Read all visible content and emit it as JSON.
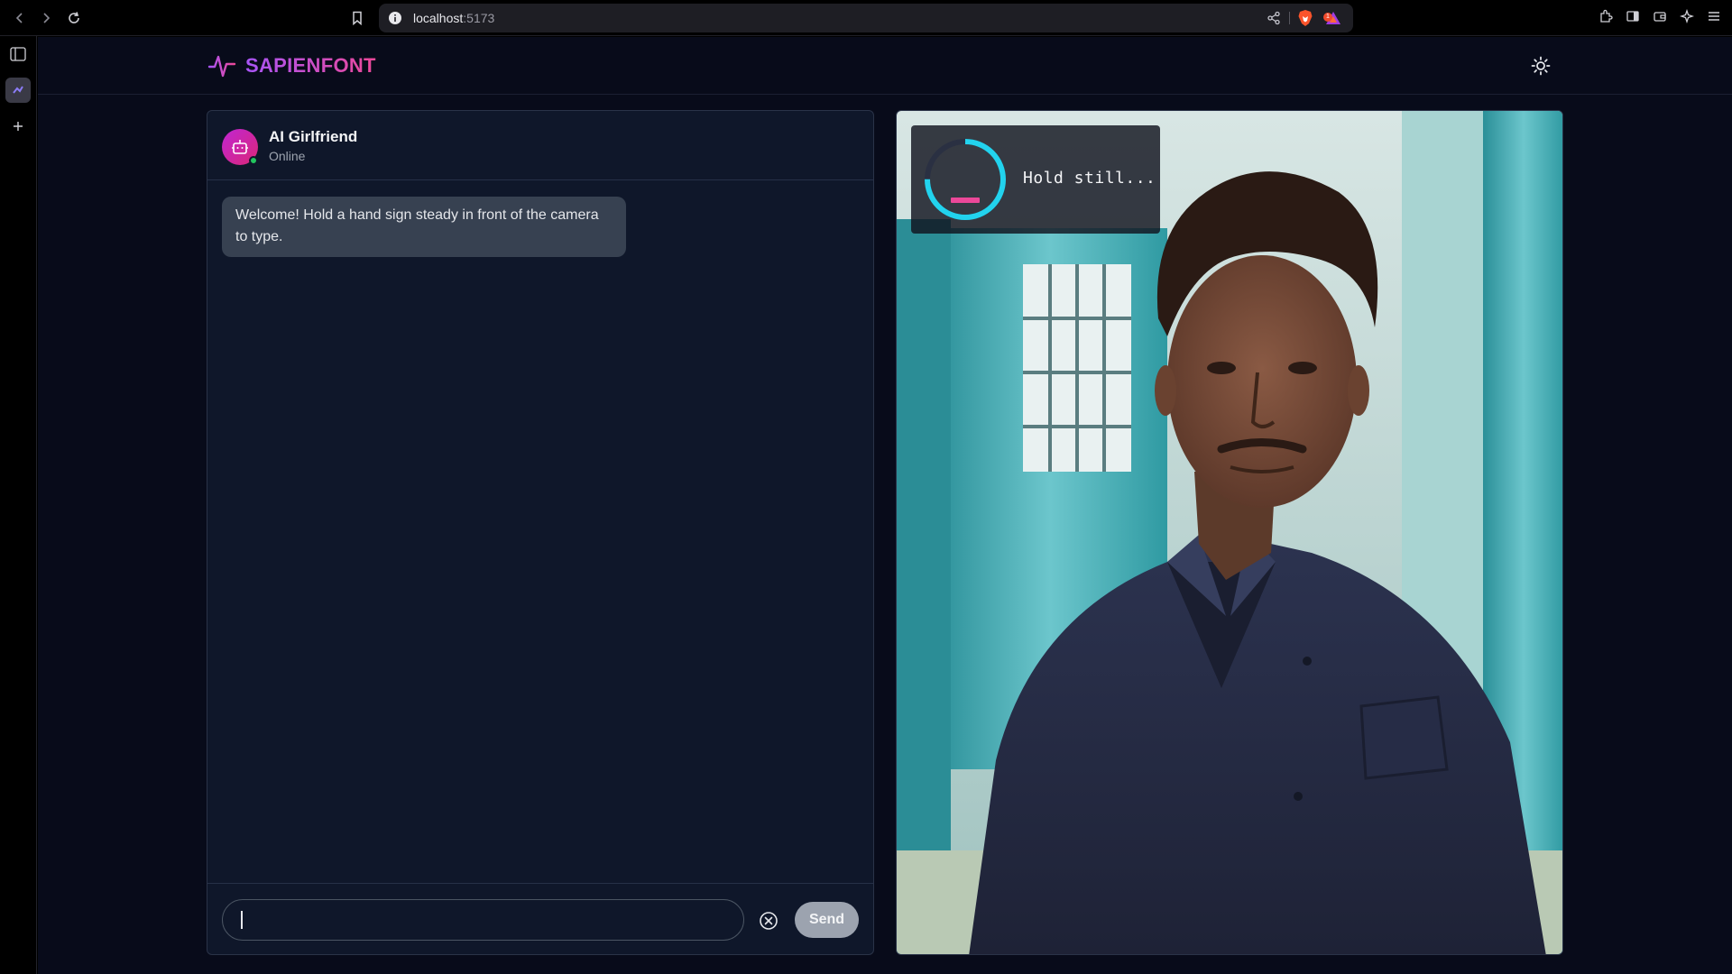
{
  "browser": {
    "url_host": "localhost",
    "url_port": ":5173",
    "rewards_badge": "1"
  },
  "header": {
    "logo_text": "SAPIENFONT"
  },
  "chat": {
    "name": "AI Girlfriend",
    "status": "Online",
    "messages": [
      {
        "text": "Welcome! Hold a hand sign steady in front of the camera to type."
      }
    ],
    "input_value": "",
    "send_label": "Send"
  },
  "camera": {
    "status_text": "Hold still...",
    "ring_progress": 0.75,
    "ring_color": "#22d3ee",
    "indicator_color": "#ec4899"
  },
  "colors": {
    "brand_gradient_start": "#a855f7",
    "brand_gradient_end": "#ec4899",
    "online": "#22c55e",
    "app_bg": "#080b1a",
    "panel_bg": "#0f172a"
  }
}
